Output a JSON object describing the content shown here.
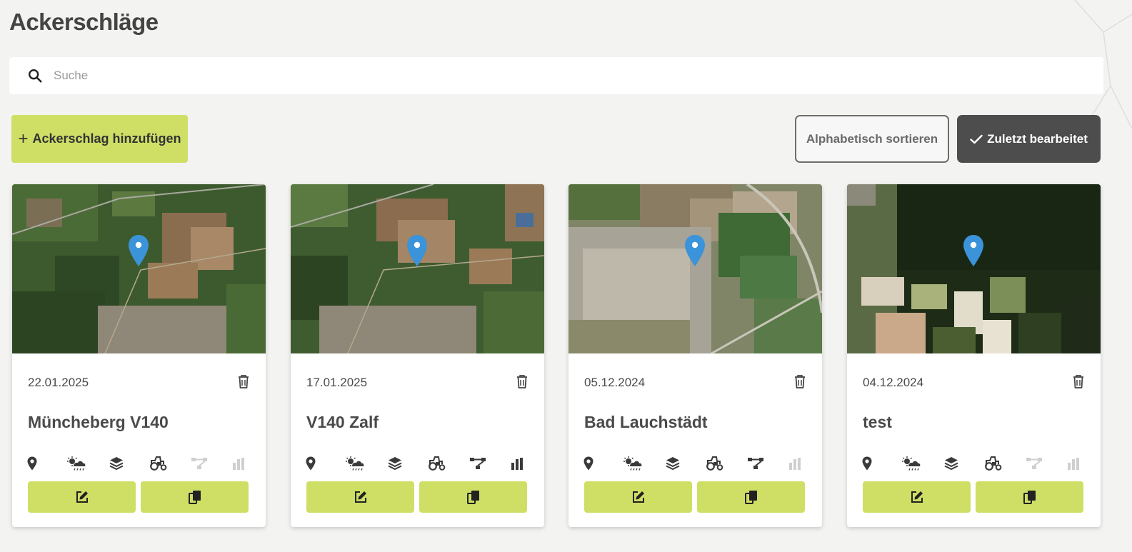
{
  "page": {
    "title": "Ackerschläge"
  },
  "search": {
    "placeholder": "Suche",
    "value": "",
    "icon": "search-icon"
  },
  "toolbar": {
    "add_label": "Ackerschlag hinzufügen",
    "sort_alpha_label": "Alphabetisch sortieren",
    "sort_recent_label": "Zuletzt bearbeitet",
    "active_sort": "Zuletzt bearbeitet"
  },
  "colors": {
    "accent": "#cfdf65",
    "active_button": "#4d4d4d",
    "pin": "#3b93d9",
    "icon_active": "#3a3a3a",
    "icon_inactive": "#cfcfcf",
    "background": "#f3f3f1"
  },
  "fields": [
    {
      "date": "22.01.2025",
      "name": "Müncheberg V140",
      "status_icons": {
        "location": true,
        "weather": true,
        "layers": true,
        "machinery": true,
        "network": false,
        "chart": false
      },
      "map_style": "forest"
    },
    {
      "date": "17.01.2025",
      "name": "V140 Zalf",
      "status_icons": {
        "location": true,
        "weather": true,
        "layers": true,
        "machinery": true,
        "network": true,
        "chart": true
      },
      "map_style": "forest"
    },
    {
      "date": "05.12.2024",
      "name": "Bad Lauchstädt",
      "status_icons": {
        "location": true,
        "weather": true,
        "layers": true,
        "machinery": true,
        "network": true,
        "chart": false
      },
      "map_style": "town"
    },
    {
      "date": "04.12.2024",
      "name": "test",
      "status_icons": {
        "location": true,
        "weather": true,
        "layers": true,
        "machinery": true,
        "network": false,
        "chart": false
      },
      "map_style": "fields"
    }
  ]
}
